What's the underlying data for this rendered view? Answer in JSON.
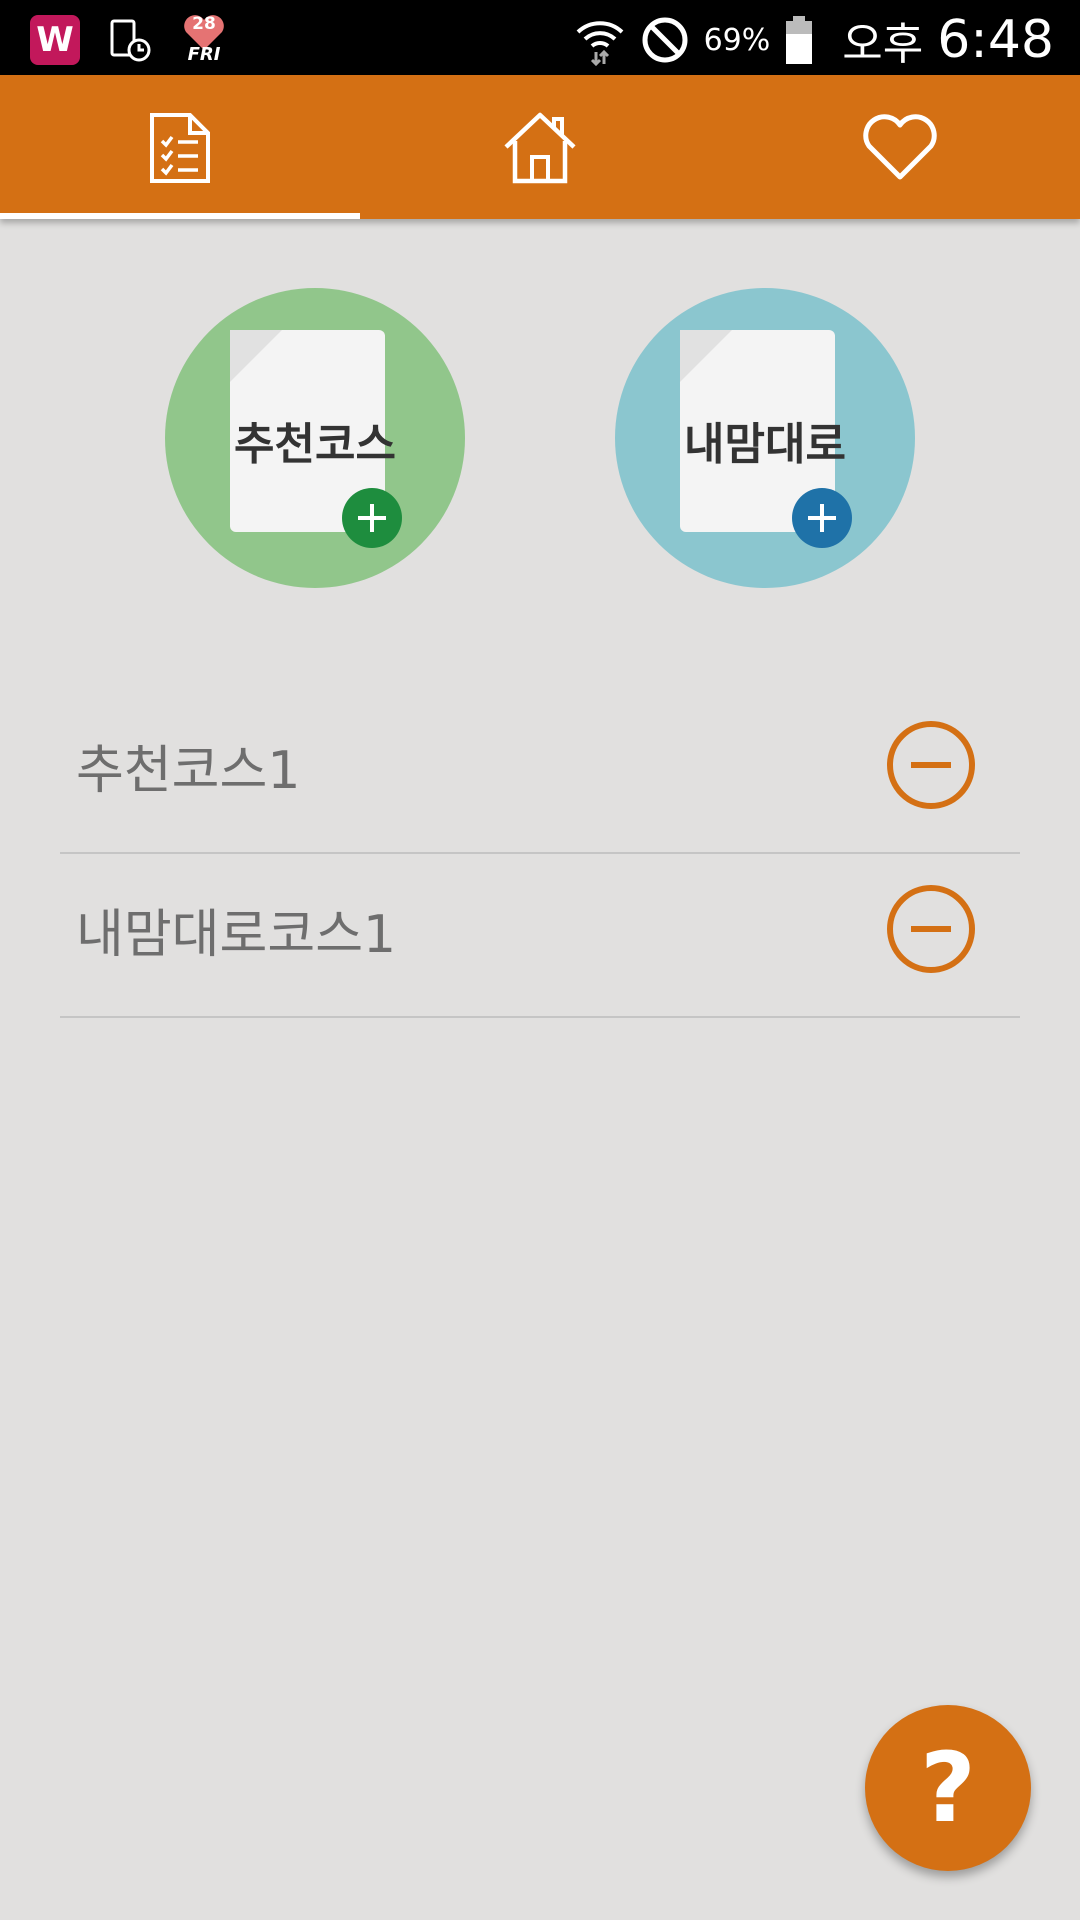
{
  "status_bar": {
    "heart_date_number": "28",
    "heart_date_day": "FRI",
    "battery": "69%",
    "ampm": "오후",
    "time": "6:48",
    "icons": [
      "w-app-icon",
      "device-clock-icon",
      "heart-calendar-icon",
      "wifi-icon",
      "do-not-disturb-icon",
      "battery-icon"
    ]
  },
  "tabs": [
    {
      "icon": "checklist-icon",
      "selected": true
    },
    {
      "icon": "home-icon",
      "selected": false
    },
    {
      "icon": "heart-icon",
      "selected": false
    }
  ],
  "quick_actions": [
    {
      "label": "추천코스",
      "color": "#91c68b",
      "plus_color": "#1e8d3e"
    },
    {
      "label": "내맘대로",
      "color": "#8bc6cf",
      "plus_color": "#1f72a8"
    }
  ],
  "courses": [
    {
      "name": "추천코스1"
    },
    {
      "name": "내맘대로코스1"
    }
  ],
  "fab": {
    "label": "?",
    "color": "#d47014"
  },
  "colors": {
    "accent": "#d47014",
    "background": "#e1e0df"
  }
}
